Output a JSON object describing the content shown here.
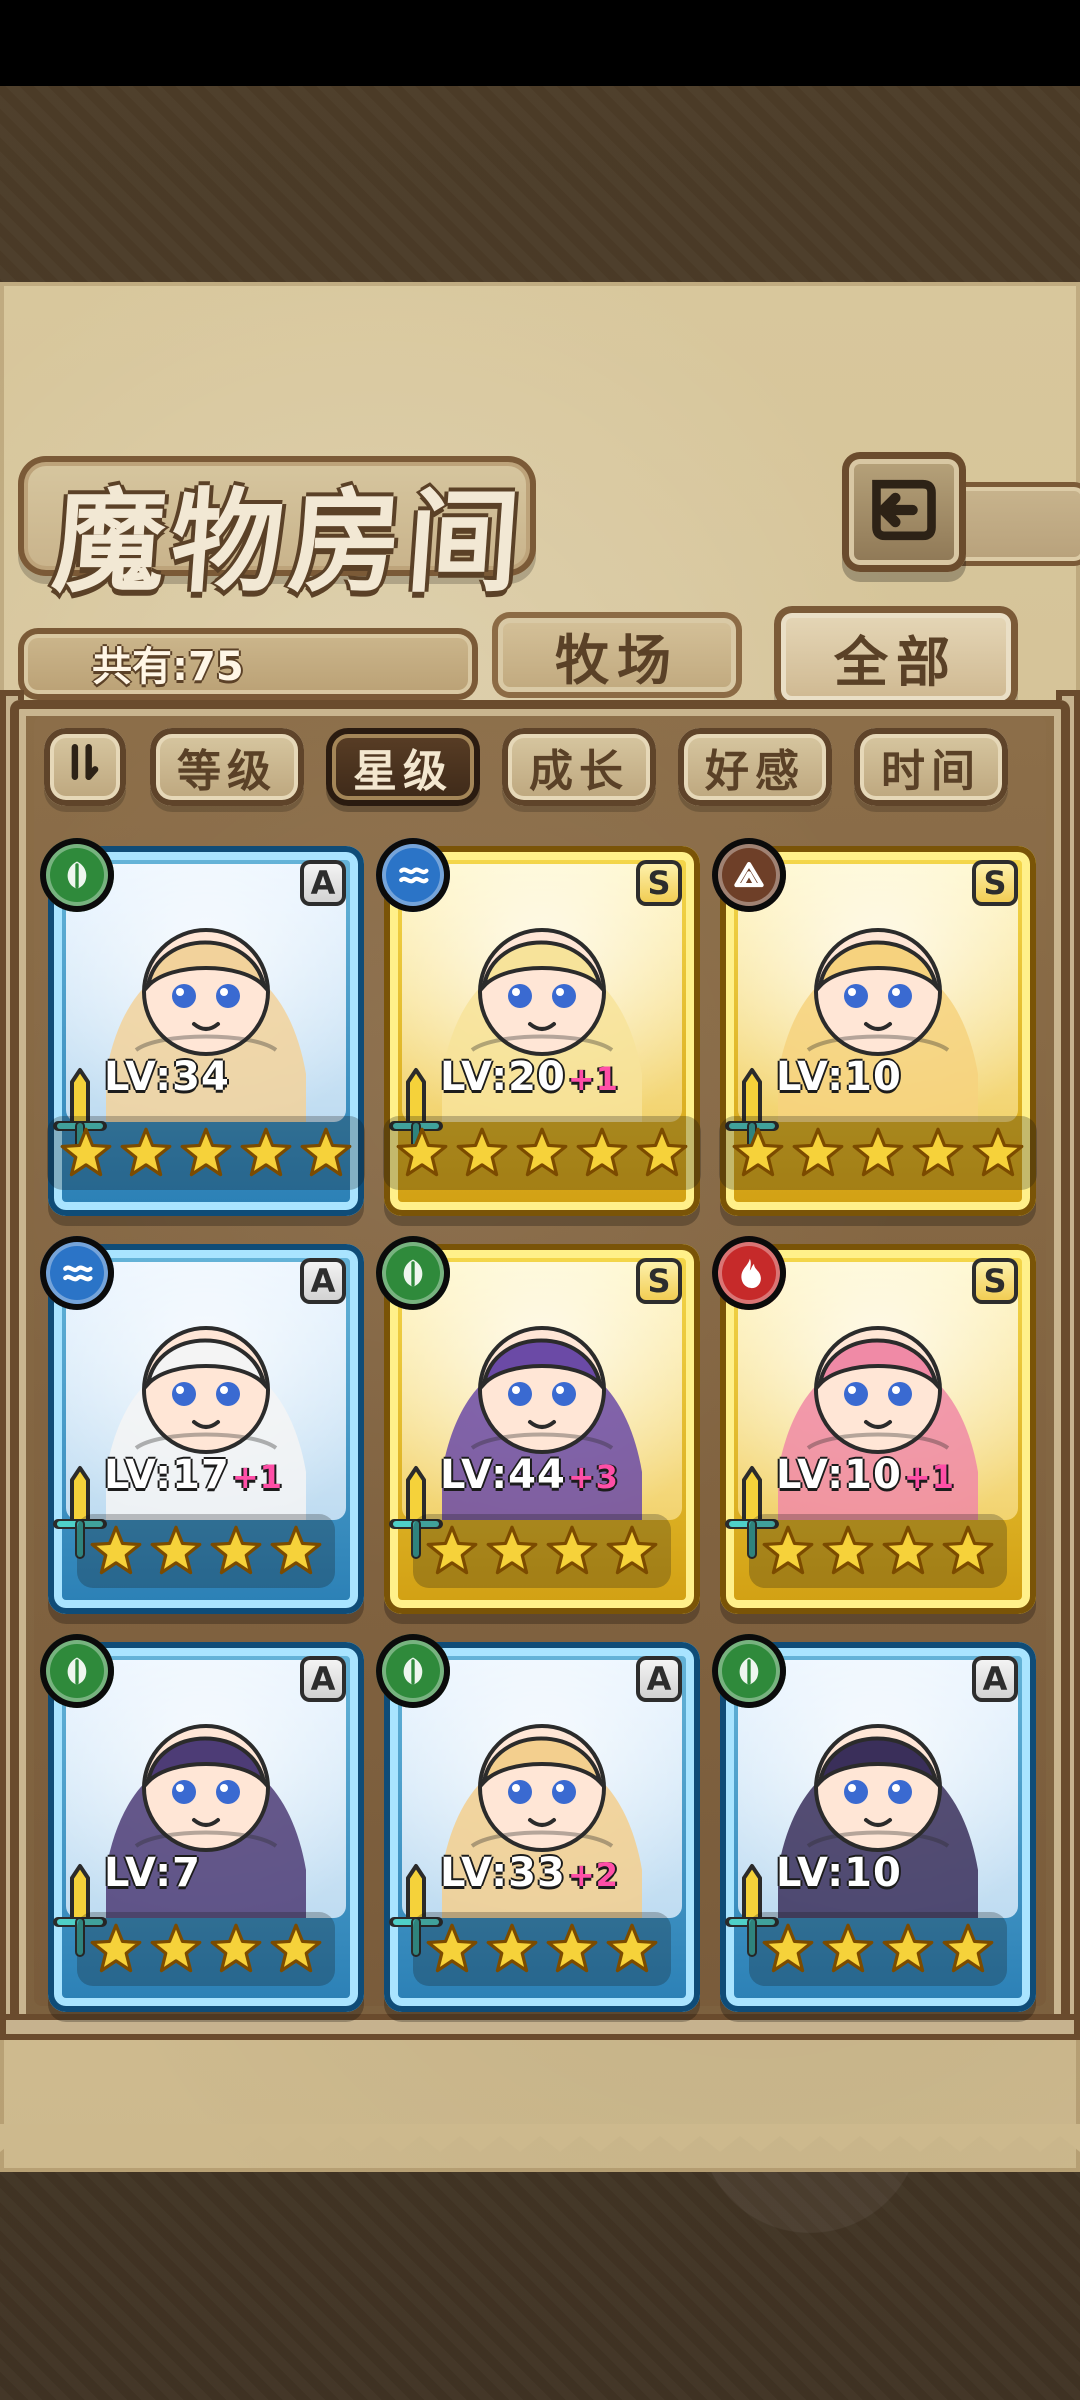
{
  "header": {
    "title": "魔物房间",
    "back_icon": "return-icon"
  },
  "tabs": [
    {
      "label": "牧场",
      "active": false
    },
    {
      "label": "全部",
      "active": true
    }
  ],
  "summary": {
    "count_label": "共有:75"
  },
  "sort": {
    "toggle_icon": "sort-toggle-icon",
    "buttons": [
      {
        "label": "等级",
        "active": false
      },
      {
        "label": "星级",
        "active": true
      },
      {
        "label": "成长",
        "active": false
      },
      {
        "label": "好感",
        "active": false
      },
      {
        "label": "时间",
        "active": false
      }
    ]
  },
  "cards": [
    {
      "rank": "A",
      "element": "leaf",
      "frame": "blue",
      "level": "LV:34",
      "plus": "",
      "stars": 5,
      "tint": "#f2d29b"
    },
    {
      "rank": "S",
      "element": "water",
      "frame": "gold",
      "level": "LV:20",
      "plus": "+1",
      "stars": 5,
      "tint": "#f7e39a"
    },
    {
      "rank": "S",
      "element": "earth",
      "frame": "gold",
      "level": "LV:10",
      "plus": "",
      "stars": 5,
      "tint": "#f6d27e"
    },
    {
      "rank": "A",
      "element": "water",
      "frame": "blue",
      "level": "LV:17",
      "plus": "+1",
      "stars": 4,
      "tint": "#f4f4f4"
    },
    {
      "rank": "S",
      "element": "leaf",
      "frame": "gold",
      "level": "LV:44",
      "plus": "+3",
      "stars": 4,
      "tint": "#6b4aa6"
    },
    {
      "rank": "S",
      "element": "fire",
      "frame": "gold",
      "level": "LV:10",
      "plus": "+1",
      "stars": 4,
      "tint": "#f08aa6"
    },
    {
      "rank": "A",
      "element": "leaf",
      "frame": "blue",
      "level": "LV:7",
      "plus": "",
      "stars": 4,
      "tint": "#4d3c76"
    },
    {
      "rank": "A",
      "element": "leaf",
      "frame": "blue",
      "level": "LV:33",
      "plus": "+2",
      "stars": 4,
      "tint": "#f3cf8e"
    },
    {
      "rank": "A",
      "element": "leaf",
      "frame": "blue",
      "level": "LV:10",
      "plus": "",
      "stars": 4,
      "tint": "#3a2f5a"
    }
  ],
  "colors": {
    "leaf": "#2f8a3b",
    "water": "#2b74c7",
    "earth": "#6e3f28",
    "fire": "#c62a2a",
    "star": "#f6d23a"
  }
}
